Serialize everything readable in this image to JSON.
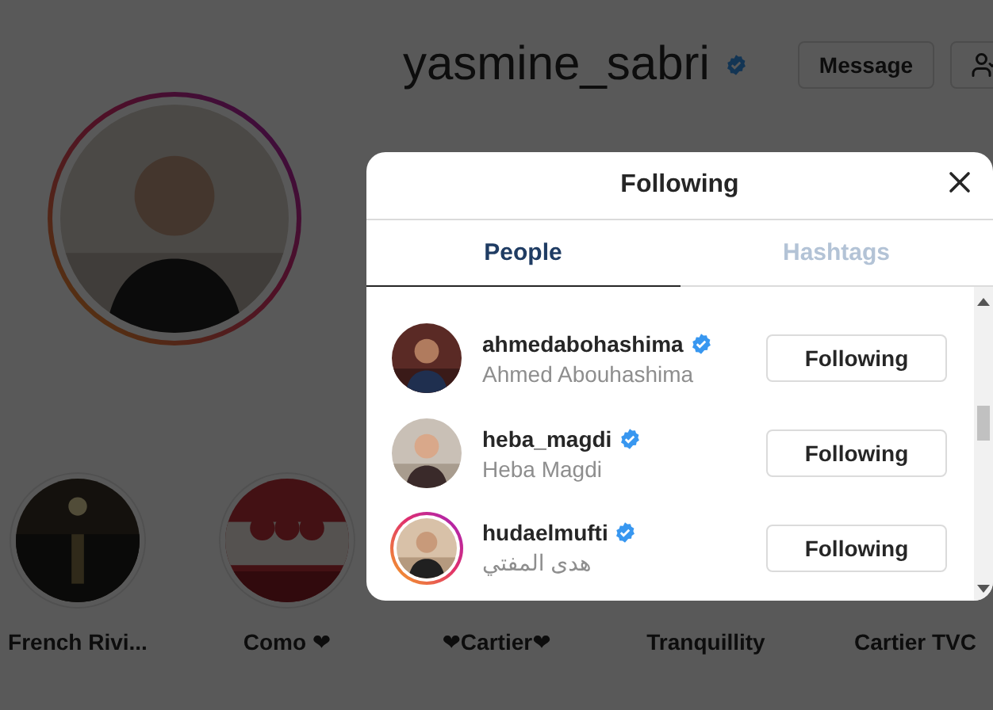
{
  "profile": {
    "username": "yasmine_sabri",
    "verified": true,
    "message_button": "Message",
    "story_ring": true
  },
  "highlights": [
    {
      "label": "French Rivi...",
      "kind": "picture"
    },
    {
      "label": "Como ❤",
      "kind": "picture"
    },
    {
      "label": "❤Cartier❤"
    },
    {
      "label": "Tranquillity"
    },
    {
      "label": "Cartier TVC"
    }
  ],
  "modal": {
    "title": "Following",
    "tabs": [
      {
        "label": "People",
        "selected": true
      },
      {
        "label": "Hashtags",
        "selected": false
      }
    ],
    "rows": [
      {
        "username": "ahmedabohashima",
        "verified": true,
        "full_name": "Ahmed Abouhashima",
        "button": "Following",
        "story_ring": false
      },
      {
        "username": "heba_magdi",
        "verified": true,
        "full_name": "Heba Magdi",
        "button": "Following",
        "story_ring": false
      },
      {
        "username": "hudaelmufti",
        "verified": true,
        "full_name": "هدى المفتي",
        "button": "Following",
        "story_ring": true
      }
    ]
  }
}
